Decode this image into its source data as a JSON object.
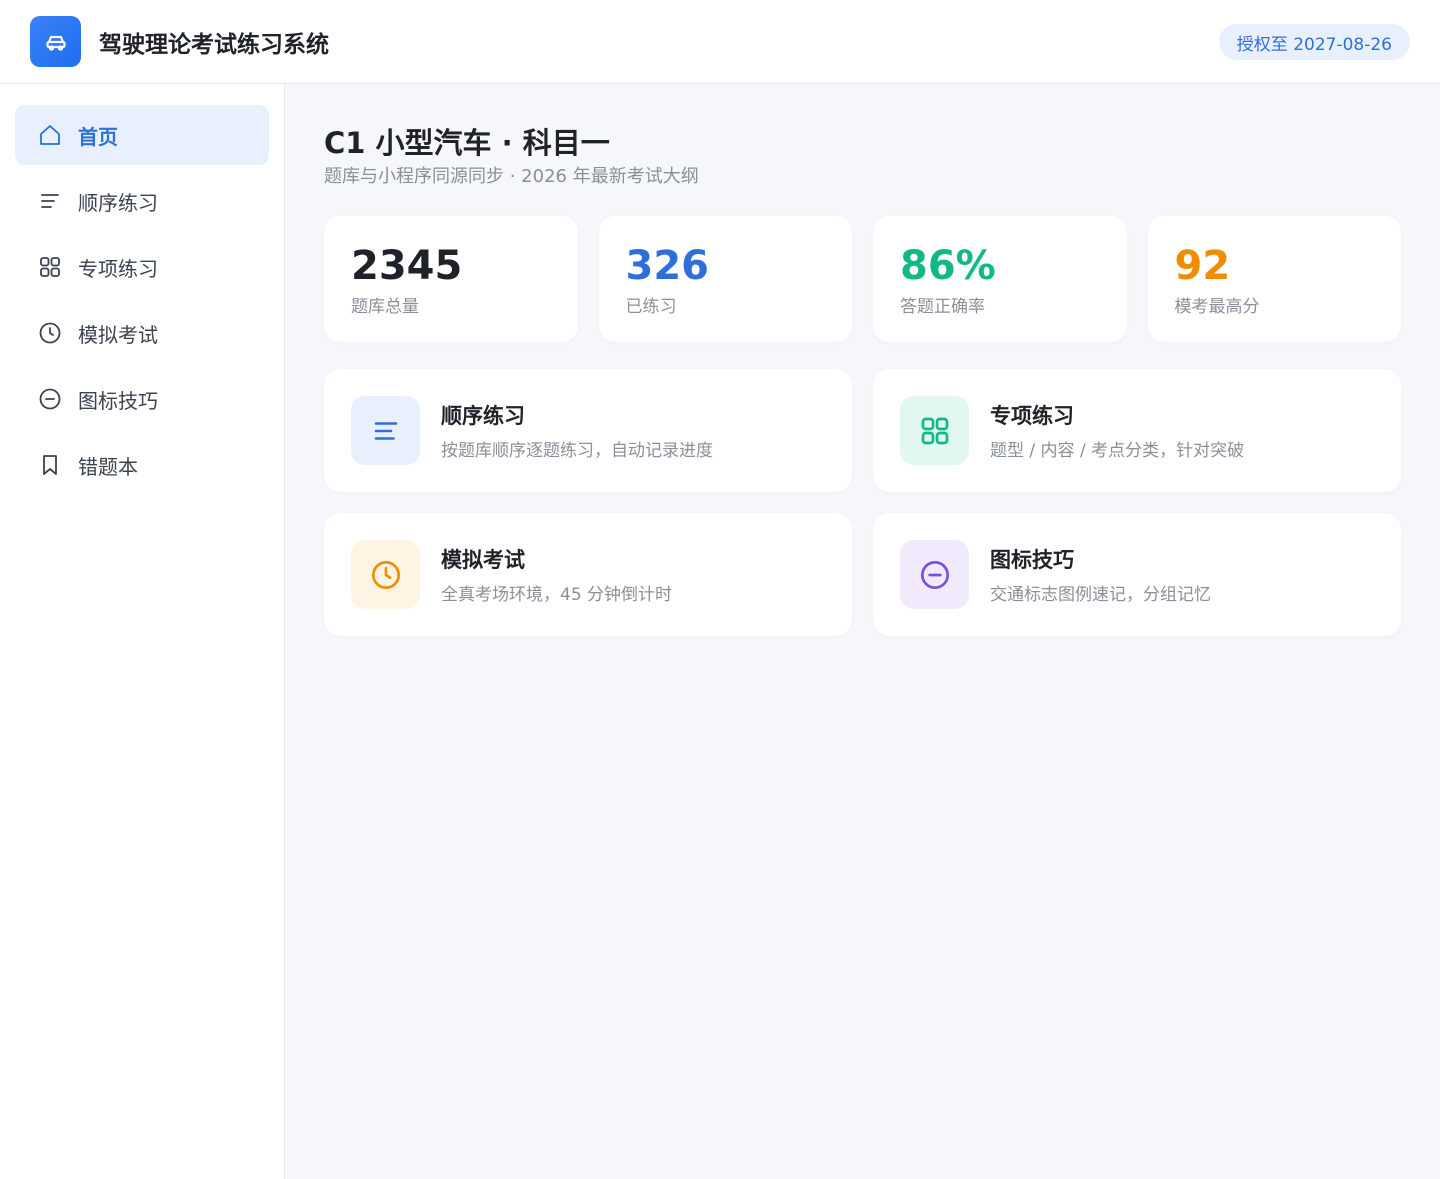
{
  "header": {
    "app_title": "驾驶理论考试练习系统",
    "license": "授权至 2027-08-26",
    "logo_icon": "car-icon"
  },
  "sidebar": {
    "items": [
      {
        "label": "首页",
        "icon": "home-icon",
        "active": true
      },
      {
        "label": "顺序练习",
        "icon": "list-icon"
      },
      {
        "label": "专项练习",
        "icon": "grid-icon"
      },
      {
        "label": "模拟考试",
        "icon": "clock-icon"
      },
      {
        "label": "图标技巧",
        "icon": "minus-circle-icon"
      },
      {
        "label": "错题本",
        "icon": "bookmark-icon"
      }
    ]
  },
  "main": {
    "title": "C1 小型汽车 · 科目一",
    "subtitle": "题库与小程序同源同步 · 2026 年最新考试大纲",
    "stats": [
      {
        "value": "2345",
        "label": "题库总量",
        "color": "#1f2329"
      },
      {
        "value": "326",
        "label": "已练习",
        "color": "#2f6fd8"
      },
      {
        "value": "86%",
        "label": "答题正确率",
        "color": "#12b886"
      },
      {
        "value": "92",
        "label": "模考最高分",
        "color": "#f08c00"
      }
    ],
    "features": [
      {
        "title": "顺序练习",
        "desc": "按题库顺序逐题练习，自动记录进度",
        "icon": "list-icon",
        "color": "#2f6fd8",
        "bg": "#e8f0fe"
      },
      {
        "title": "专项练习",
        "desc": "题型 / 内容 / 考点分类，针对突破",
        "icon": "grid-icon",
        "color": "#12b886",
        "bg": "#e3f7f1"
      },
      {
        "title": "模拟考试",
        "desc": "全真考场环境，45 分钟倒计时",
        "icon": "clock-icon",
        "color": "#f08c00",
        "bg": "#fff3e3"
      },
      {
        "title": "图标技巧",
        "desc": "交通标志图例速记，分组记忆",
        "icon": "minus-circle-icon",
        "color": "#7c4dde",
        "bg": "#f0eafc"
      }
    ]
  }
}
